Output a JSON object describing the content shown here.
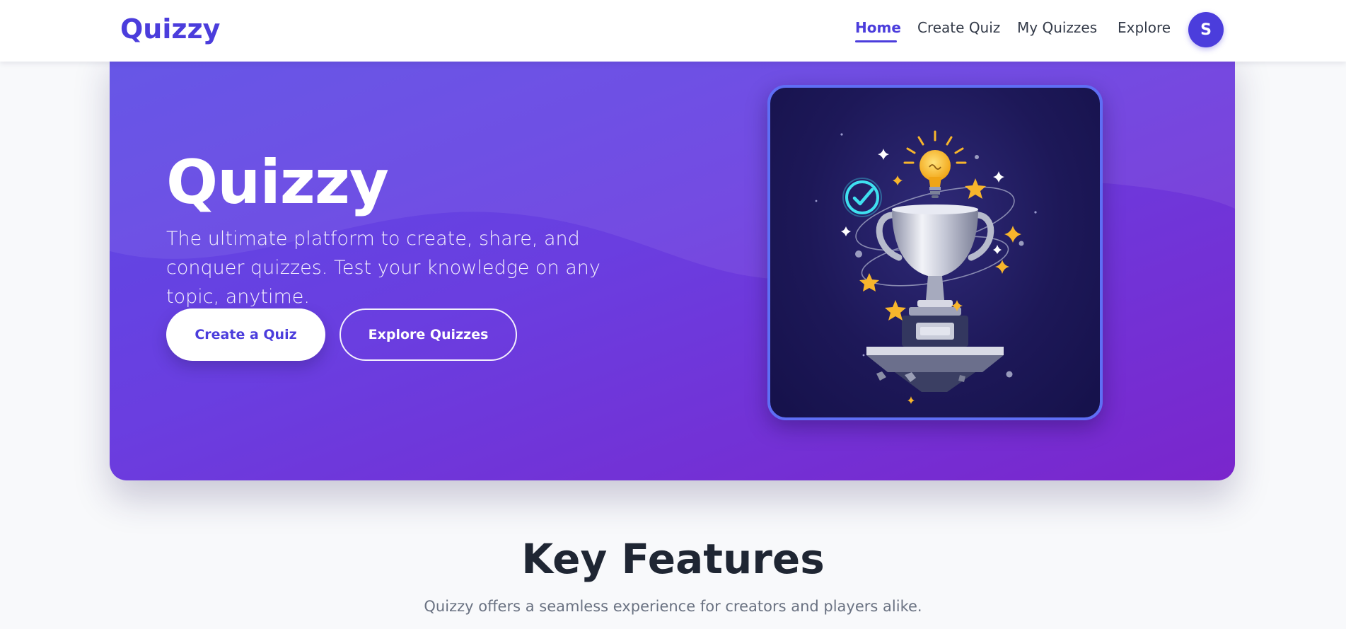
{
  "header": {
    "logo": "Quizzy",
    "nav": [
      {
        "label": "Home",
        "active": true
      },
      {
        "label": "Create Quiz",
        "active": false
      },
      {
        "label": "My Quizzes",
        "active": false
      },
      {
        "label": "Explore",
        "active": false
      }
    ],
    "avatar_initial": "S"
  },
  "hero": {
    "title": "Quizzy",
    "subtitle": "The ultimate platform to create, share, and conquer quizzes. Test your knowledge on any topic, anytime.",
    "primary_button": "Create a Quiz",
    "secondary_button": "Explore Quizzes",
    "illustration": {
      "icons": [
        "trophy-icon",
        "lightbulb-icon",
        "checkmark-icon",
        "star-icon",
        "sparkle-icon"
      ]
    }
  },
  "features": {
    "title": "Key Features",
    "subtitle": "Quizzy offers a seamless experience for creators and players alike."
  },
  "colors": {
    "brand": "#4b3ddc",
    "hero_gradient_start": "#5b4be6",
    "hero_gradient_end": "#7a26cc",
    "page_background": "#f8f9fb",
    "card_border": "#5f6ef5",
    "accent_gold": "#f7b52c",
    "accent_cyan": "#3fe0f0"
  }
}
